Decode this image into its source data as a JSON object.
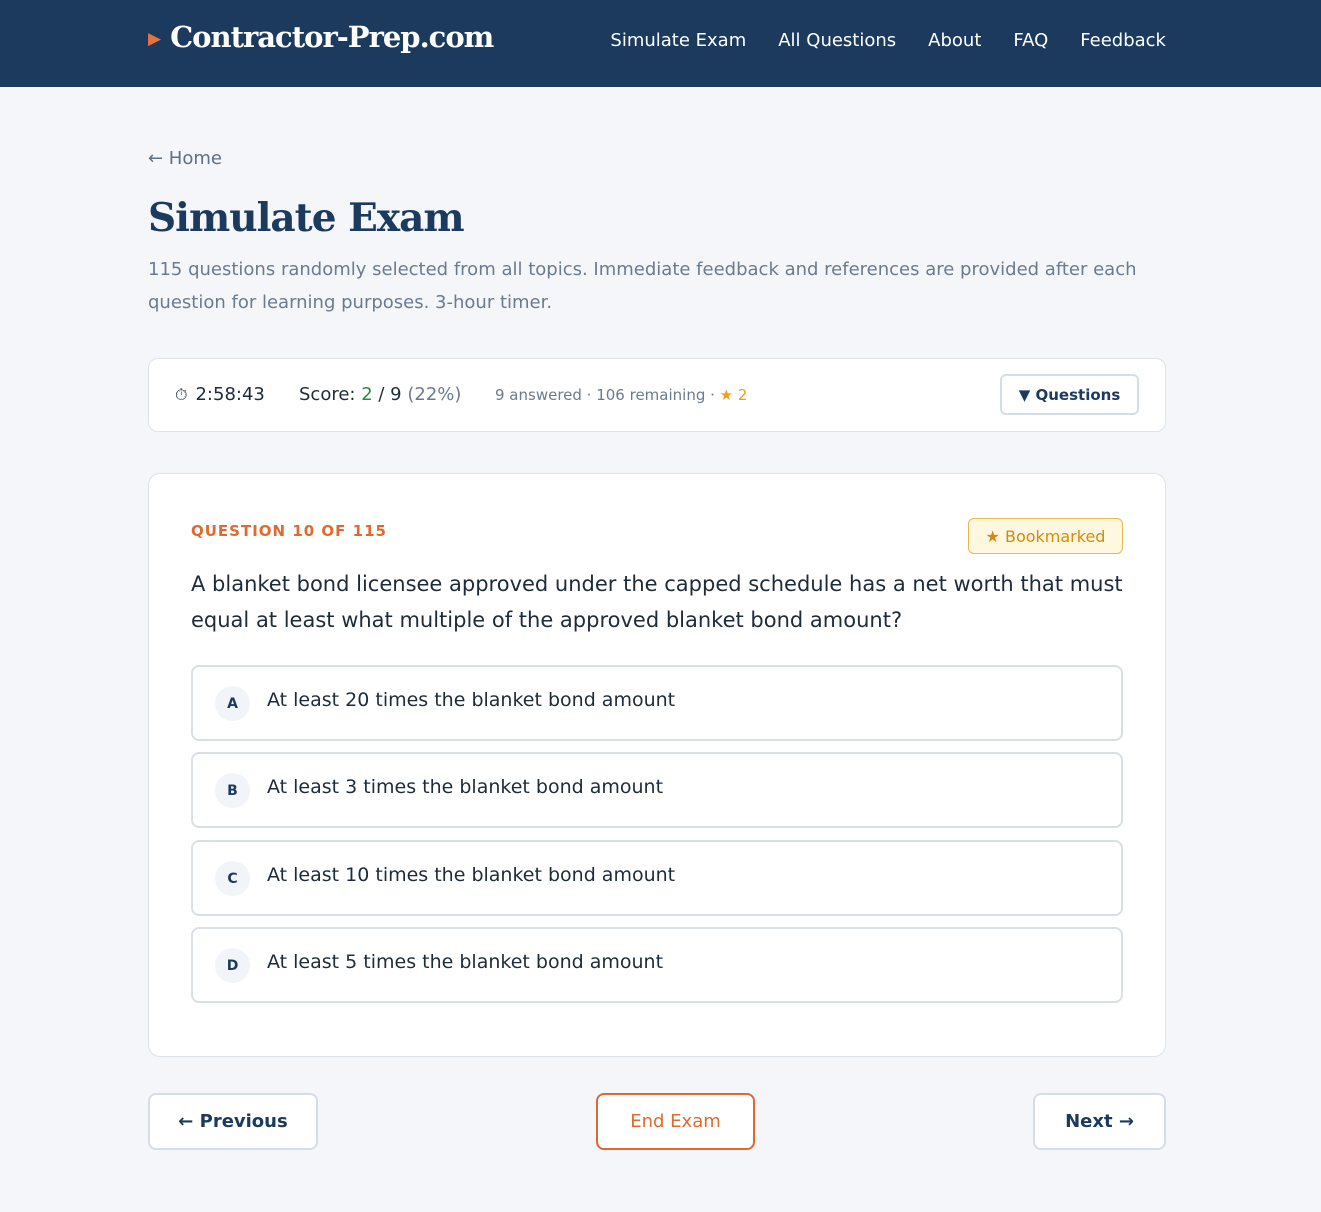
{
  "brand": {
    "arrow": "▶",
    "name": "Contractor-Prep.com"
  },
  "nav": [
    "Simulate Exam",
    "All Questions",
    "About",
    "FAQ",
    "Feedback"
  ],
  "breadcrumb": {
    "home": "← Home"
  },
  "page": {
    "title": "Simulate Exam",
    "description": "115 questions randomly selected from all topics. Immediate feedback and references are provided after each question for learning purposes. 3-hour timer."
  },
  "status": {
    "timer_icon": "⏱",
    "timer": "2:58:43",
    "score_label": "Score: ",
    "score_correct": "2",
    "score_sep": " / ",
    "score_total": "9",
    "score_pct": " (22%)",
    "progress": "9 answered · 106 remaining · ",
    "bookmarks": "★ 2",
    "questions_button": "▼ Questions"
  },
  "question": {
    "counter": "QUESTION 10 OF 115",
    "bookmark_badge": "★ Bookmarked",
    "text": "A blanket bond licensee approved under the capped schedule has a net worth that must equal at least what multiple of the approved blanket bond amount?",
    "options": [
      {
        "letter": "A",
        "text": "At least 20 times the blanket bond amount"
      },
      {
        "letter": "B",
        "text": "At least 3 times the blanket bond amount"
      },
      {
        "letter": "C",
        "text": "At least 10 times the blanket bond amount"
      },
      {
        "letter": "D",
        "text": "At least 5 times the blanket bond amount"
      }
    ]
  },
  "footer": {
    "previous": "← Previous",
    "end_exam": "End Exam",
    "next": "Next →"
  },
  "colors": {
    "navy": "#1c3a5e",
    "accent_orange": "#e0692f",
    "correct_green": "#2e8b3d",
    "bookmark_gold": "#e9a01c"
  }
}
